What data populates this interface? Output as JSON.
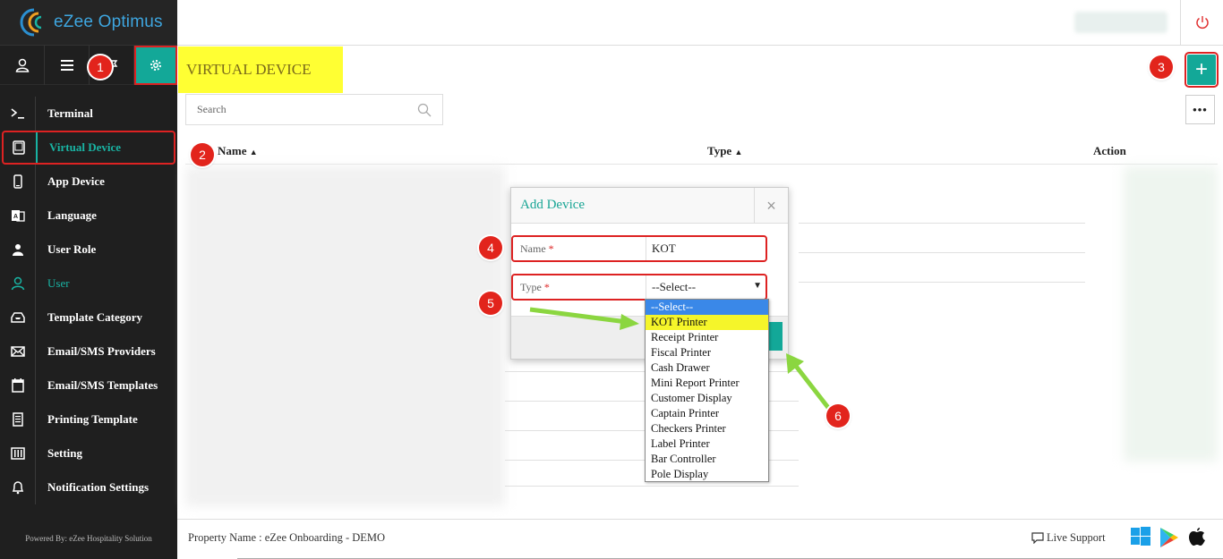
{
  "app": {
    "logo_text": "eZee Optimus"
  },
  "page": {
    "title": "VIRTUAL DEVICE"
  },
  "search": {
    "placeholder": "Search"
  },
  "toolbar": {
    "add_label": "+",
    "more_label": "•••"
  },
  "table": {
    "columns": [
      "Name",
      "Type",
      "Action"
    ],
    "sort_indicator": "▲"
  },
  "sidebar": {
    "items": [
      {
        "label": "Terminal",
        "icon": "terminal-icon"
      },
      {
        "label": "Virtual Device",
        "icon": "tablet-icon"
      },
      {
        "label": "App Device",
        "icon": "mobile-icon"
      },
      {
        "label": "Language",
        "icon": "language-icon"
      },
      {
        "label": "User Role",
        "icon": "user-role-icon"
      },
      {
        "label": "User",
        "icon": "user-icon"
      },
      {
        "label": "Template Category",
        "icon": "inbox-icon"
      },
      {
        "label": "Email/SMS Providers",
        "icon": "envelope-icon"
      },
      {
        "label": "Email/SMS Templates",
        "icon": "calendar-icon"
      },
      {
        "label": "Printing Template",
        "icon": "receipt-icon"
      },
      {
        "label": "Setting",
        "icon": "sliders-icon"
      },
      {
        "label": "Notification Settings",
        "icon": "bell-icon"
      }
    ],
    "powered_by": "Powered By: eZee Hospitality Solution"
  },
  "modal": {
    "title": "Add Device",
    "close_label": "×",
    "name_label": "Name",
    "name_value": "KOT",
    "type_label": "Type",
    "type_value": "--Select--",
    "required_mark": "*"
  },
  "dropdown": {
    "options": [
      "--Select--",
      "KOT Printer",
      "Receipt Printer",
      "Fiscal Printer",
      "Cash Drawer",
      "Mini Report Printer",
      "Customer Display",
      "Captain Printer",
      "Checkers Printer",
      "Label Printer",
      "Bar Controller",
      "Pole Display"
    ]
  },
  "markers": [
    "1",
    "2",
    "3",
    "4",
    "5",
    "6"
  ],
  "footer": {
    "property_name": "Property Name : eZee Onboarding - DEMO",
    "live_support": "Live Support"
  },
  "colors": {
    "accent": "#13a898",
    "marker": "#e2241c",
    "highlight": "#ffff33",
    "selected": "#3a88e8"
  }
}
